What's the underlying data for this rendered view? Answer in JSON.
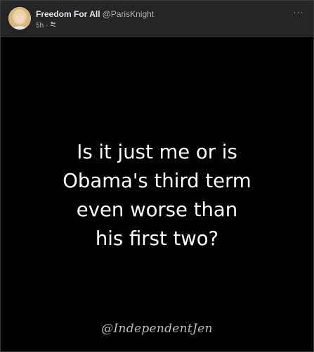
{
  "post": {
    "page_name": "Freedom For All",
    "handle": "@ParisKnight",
    "time": "5h",
    "separator": "·",
    "audience_icon": "friends-icon",
    "more_label": "···",
    "text_lines": [
      "Is it just me or is",
      "Obama's third term",
      "even worse than",
      "his first two?"
    ],
    "watermark": "@IndependentJen"
  },
  "colors": {
    "background": "#000000",
    "header": "#242526",
    "name": "#e4e6eb",
    "secondary": "#b0b3b8",
    "quote": "#ffffff"
  }
}
